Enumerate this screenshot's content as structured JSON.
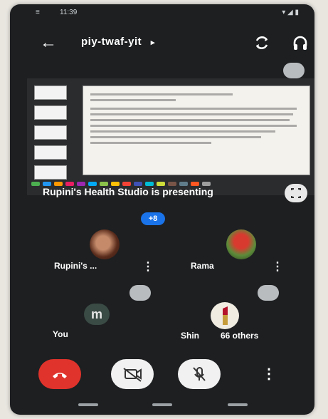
{
  "status_bar": {
    "time": "11:39"
  },
  "header": {
    "meeting_code": "piy-twaf-yit",
    "chevron": "▸"
  },
  "presentation": {
    "presenting_text": "Rupini's Health Studio is presenting"
  },
  "activity": {
    "badge": "+8"
  },
  "participants": [
    {
      "name": "Rupini's ...",
      "avatar": "photo"
    },
    {
      "name": "Rama",
      "avatar": "photo"
    },
    {
      "name": "You",
      "avatar_initial": "m"
    },
    {
      "name": "Shin",
      "avatar": "photo",
      "others_label": "66 others"
    }
  ],
  "controls": {
    "end_call_icon": "end-call-icon",
    "camera_icon": "camera-off-icon",
    "mic_icon": "mic-off-icon"
  },
  "colors": {
    "background": "#1d1f21",
    "end_call": "#e0332b",
    "accent": "#1a73e8"
  }
}
